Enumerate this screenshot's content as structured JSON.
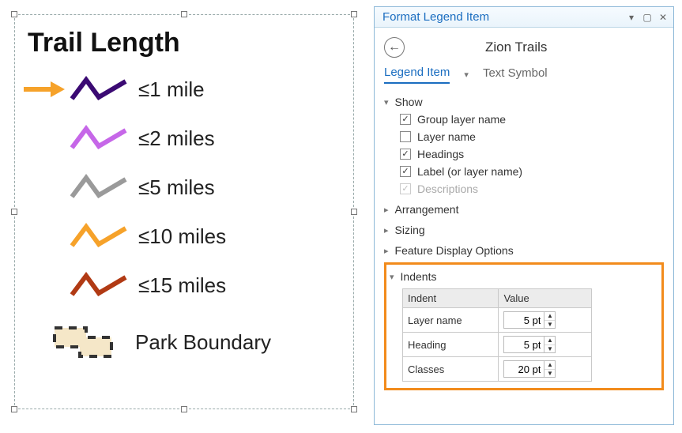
{
  "legend": {
    "title": "Trail Length",
    "items": [
      {
        "label": "≤1 mile",
        "color": "#3b0a73",
        "selected": true
      },
      {
        "label": "≤2 miles",
        "color": "#c667e8",
        "selected": false
      },
      {
        "label": "≤5 miles",
        "color": "#9a9a9a",
        "selected": false
      },
      {
        "label": "≤10 miles",
        "color": "#f6a22a",
        "selected": false
      },
      {
        "label": "≤15 miles",
        "color": "#b13a14",
        "selected": false
      }
    ],
    "boundary_label": "Park Boundary"
  },
  "panel": {
    "title": "Format Legend Item",
    "subtitle": "Zion Trails",
    "tabs": {
      "active": "Legend Item",
      "other": "Text Symbol"
    },
    "sections": {
      "show": {
        "label": "Show",
        "options": [
          {
            "label": "Group layer name",
            "checked": true,
            "disabled": false
          },
          {
            "label": "Layer name",
            "checked": false,
            "disabled": false
          },
          {
            "label": "Headings",
            "checked": true,
            "disabled": false
          },
          {
            "label": "Label (or layer name)",
            "checked": true,
            "disabled": false
          },
          {
            "label": "Descriptions",
            "checked": true,
            "disabled": true
          }
        ]
      },
      "arrangement": "Arrangement",
      "sizing": "Sizing",
      "feature_display": "Feature Display Options",
      "indents": {
        "label": "Indents",
        "columns": {
          "indent": "Indent",
          "value": "Value"
        },
        "rows": [
          {
            "name": "Layer name",
            "value": "5 pt"
          },
          {
            "name": "Heading",
            "value": "5 pt"
          },
          {
            "name": "Classes",
            "value": "20 pt"
          }
        ]
      }
    }
  },
  "arrow_color": "#f6a22a"
}
